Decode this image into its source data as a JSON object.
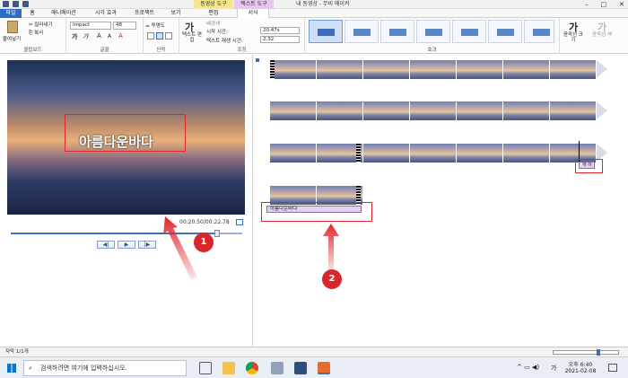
{
  "window": {
    "title": "내 동영상 - 무비 메이커",
    "context_tab_video": "동영상 도구",
    "context_tab_text": "텍스트 도구"
  },
  "tabs": [
    "파일",
    "홈",
    "애니메이션",
    "시각 효과",
    "프로젝트",
    "보기",
    "편집",
    "서식"
  ],
  "ribbon": {
    "clipboard": {
      "paste": "붙여넣기",
      "cut": "잘라내기",
      "copy": "복사",
      "group": "클립보드"
    },
    "font": {
      "family": "Impact",
      "size": "48",
      "group": "글꼴",
      "bold": "가",
      "italic": "가",
      "grow": "A",
      "shrink": "A"
    },
    "paragraph": {
      "transparency": "투명도",
      "group": "단락"
    },
    "adjust": {
      "text_edit": "텍스트 편집",
      "bg_color": "배경색",
      "start_time_label": "시작 시간:",
      "start_time": "20.47s",
      "duration_label": "텍스트 재생 시간:",
      "duration": "2.32",
      "group": "조정"
    },
    "effects": {
      "group": "효과"
    },
    "outline": {
      "size": "윤곽선 크기",
      "color": "윤곽선 색"
    }
  },
  "preview": {
    "caption": "아름다운바다",
    "time": "00:20.50/00:22.78",
    "seek_progress": 0.88
  },
  "timeline": {
    "text_clip_label": "아름다운바다",
    "mini_text_label": "개 아"
  },
  "annotations": {
    "badge1": "1",
    "badge2": "2"
  },
  "status": {
    "item_count": "자막 1/1개"
  },
  "taskbar": {
    "search_placeholder": "검색하려면 여기에 입력하십시오.",
    "lang": "가",
    "time": "오후 6:40",
    "date": "2021-02-08"
  }
}
